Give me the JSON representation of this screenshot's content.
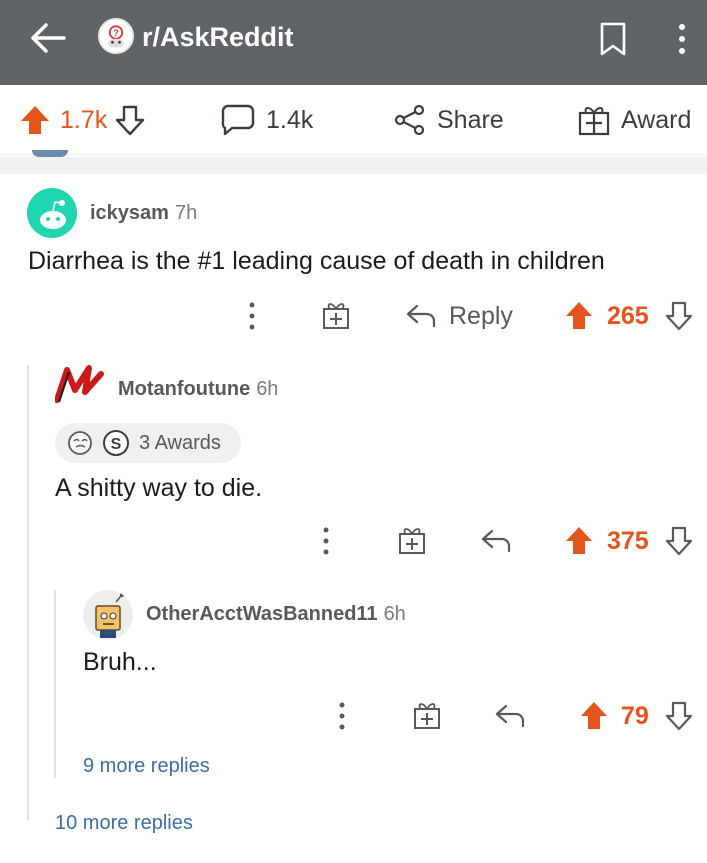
{
  "header": {
    "subreddit": "r/AskReddit",
    "icons": {
      "back": "arrow-left-icon",
      "avatar": "subreddit-avatar",
      "bookmark": "bookmark-icon",
      "more": "kebab-menu-icon"
    }
  },
  "post_actions": {
    "upvotes": "1.7k",
    "comments": "1.4k",
    "share": "Share",
    "award": "Award"
  },
  "comments": [
    {
      "user": "ickysam",
      "time": "7h",
      "body": "Diarrhea is the #1 leading cause of death in children",
      "reply_label": "Reply",
      "score": "265"
    },
    {
      "user": "Motanfoutune",
      "time": "6h",
      "awards": "3 Awards",
      "body": "A shitty way to die.",
      "score": "375"
    },
    {
      "user": "OtherAcctWasBanned11",
      "time": "6h",
      "body": "Bruh...",
      "score": "79",
      "more_replies": "9 more replies"
    }
  ],
  "more_replies": "10 more replies",
  "colors": {
    "appbar": "#5f6469",
    "upvote": "#e4541b",
    "link": "#3a6fa8",
    "text": "#1c1c1c",
    "muted": "#555a5e"
  }
}
